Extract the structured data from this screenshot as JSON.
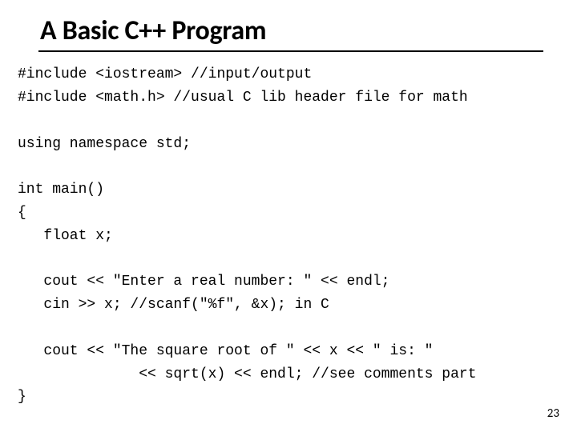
{
  "slide": {
    "title": "A Basic C++ Program",
    "code_lines": {
      "l01": "#include <iostream> //input/output",
      "l02": "#include <math.h> //usual C lib header file for math",
      "l03": "",
      "l04": "using namespace std;",
      "l05": "",
      "l06": "int main()",
      "l07": "{",
      "l08": "   float x;",
      "l09": "",
      "l10": "   cout << \"Enter a real number: \" << endl;",
      "l11": "   cin >> x; //scanf(\"%f\", &x); in C",
      "l12": "",
      "l13": "   cout << \"The square root of \" << x << \" is: \"",
      "l14": "              << sqrt(x) << endl; //see comments part",
      "l15": "}"
    },
    "page_number": "23"
  }
}
